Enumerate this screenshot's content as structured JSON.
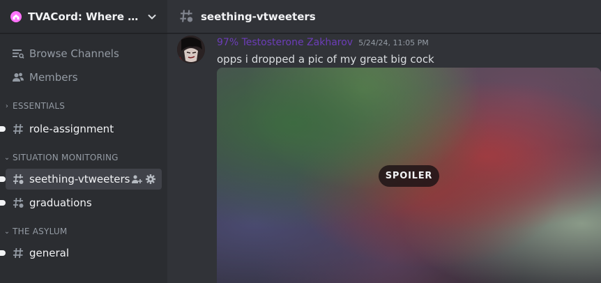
{
  "server": {
    "name": "TVACord: Where Man..."
  },
  "nav": {
    "browse_channels": "Browse Channels",
    "members": "Members"
  },
  "categories": [
    {
      "name": "ESSENTIALS",
      "channels": [
        "role-assignment"
      ]
    },
    {
      "name": "SITUATION MONITORING",
      "channels": [
        "seething-vtweeters",
        "graduations"
      ]
    },
    {
      "name": "THE ASYLUM",
      "channels": [
        "general"
      ]
    }
  ],
  "channel": {
    "current": "seething-vtweeters"
  },
  "message": {
    "author": "97% Testosterone Zakharov",
    "author_color": "#6c3db8",
    "timestamp": "5/24/24, 11:05 PM",
    "text": "opps i dropped a pic of my great big cock",
    "attachment": {
      "spoiler_label": "SPOILER"
    }
  },
  "icons": {
    "server": "home-icon",
    "dropdown": "chevron-down-icon",
    "browse": "browse-channels-icon",
    "members": "members-icon",
    "hash": "hash-icon",
    "add_member": "invite-icon",
    "settings": "gear-icon"
  }
}
